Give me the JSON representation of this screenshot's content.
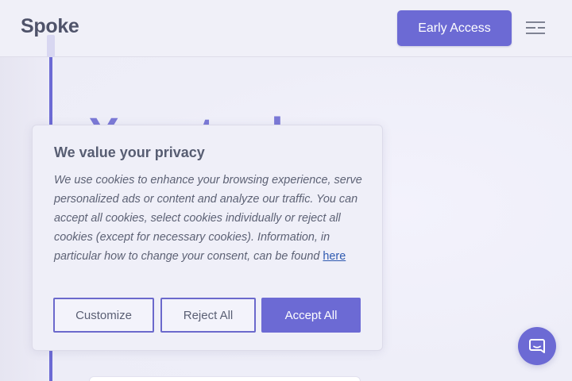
{
  "header": {
    "logo": "Spoke",
    "cta_label": "Early Access",
    "menu_icon": "hamburger-menu-icon"
  },
  "hero": {
    "partial_heading": "Your to-do list"
  },
  "cookie_banner": {
    "title": "We value your privacy",
    "body": "We use cookies to enhance your browsing experience, serve personalized ads or content and analyze our traffic. You can accept all cookies, select cookies individually or reject all cookies (except for necessary cookies). Information, in particular how to change your consent, can be found ",
    "link_label": "here",
    "buttons": {
      "customize": "Customize",
      "reject": "Reject All",
      "accept": "Accept All"
    }
  },
  "chat": {
    "icon": "chat-bubble-icon"
  },
  "colors": {
    "accent": "#6c6ad4",
    "text": "#575d72",
    "link": "#2f5ab0"
  }
}
